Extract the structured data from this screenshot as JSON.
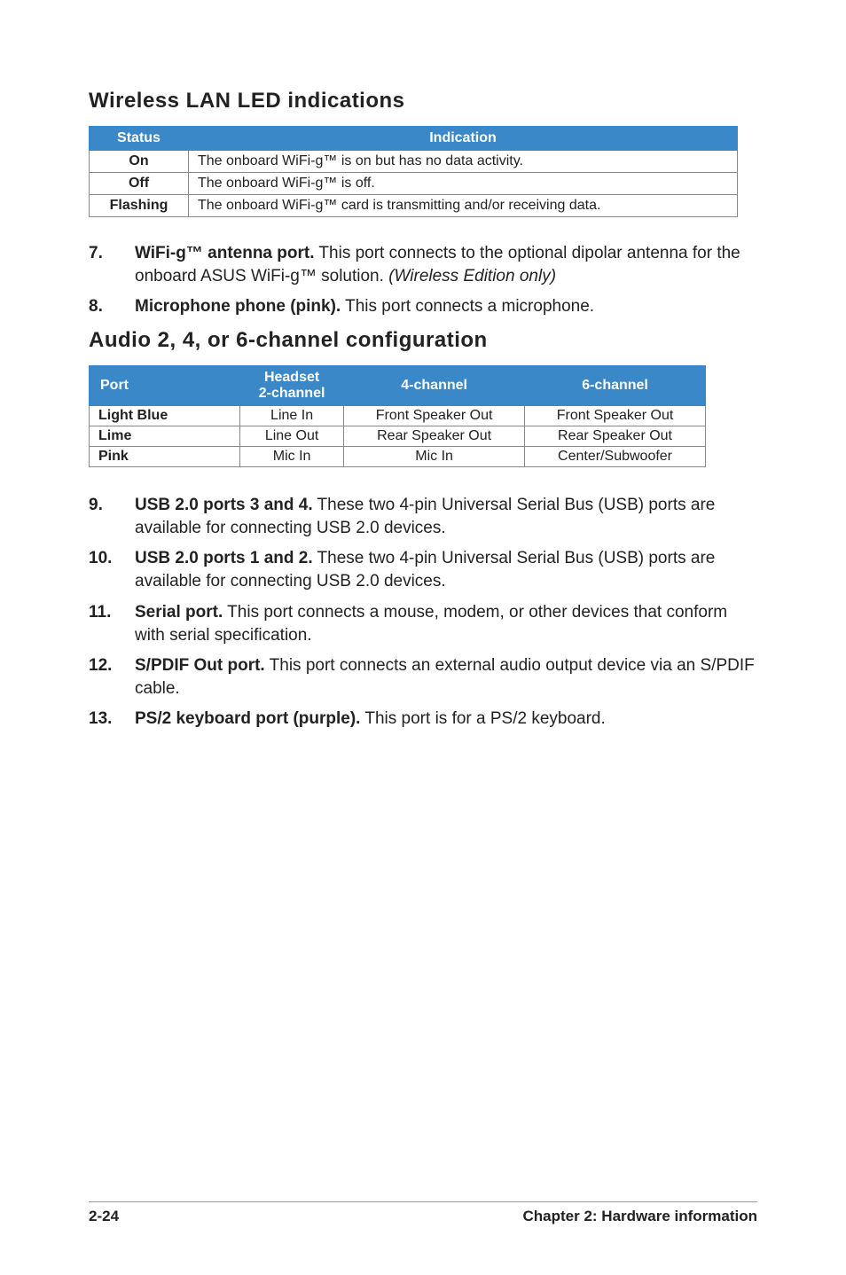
{
  "section1_title": "Wireless LAN LED indications",
  "t1": {
    "headers": {
      "status": "Status",
      "indication": "Indication"
    },
    "rows": [
      {
        "status": "On",
        "indication": "The onboard WiFi-g™ is on but has no data activity."
      },
      {
        "status": "Off",
        "indication": "The onboard WiFi-g™ is off."
      },
      {
        "status": "Flashing",
        "indication": "The onboard WiFi-g™ card is transmitting and/or receiving data."
      }
    ]
  },
  "item7": {
    "num": "7.",
    "bold": "WiFi-g™ antenna port.",
    "text": " This port connects to the optional dipolar antenna for the onboard ASUS WiFi-g™ solution. ",
    "ital": "(Wireless Edition only)"
  },
  "item8": {
    "num": "8.",
    "bold": "Microphone phone (pink).",
    "text": " This port connects a microphone."
  },
  "section2_title": "Audio 2, 4, or 6-channel configuration",
  "t2": {
    "headers": {
      "port": "Port",
      "headset": "Headset",
      "headset_sub": "2-channel",
      "ch4": "4-channel",
      "ch6": "6-channel"
    },
    "rows": [
      {
        "port": "Light Blue",
        "c1": "Line In",
        "c2": "Front Speaker Out",
        "c3": "Front Speaker Out"
      },
      {
        "port": "Lime",
        "c1": "Line Out",
        "c2": "Rear Speaker Out",
        "c3": "Rear Speaker Out"
      },
      {
        "port": "Pink",
        "c1": "Mic In",
        "c2": "Mic In",
        "c3": "Center/Subwoofer"
      }
    ]
  },
  "item9": {
    "num": "9.",
    "bold": "USB 2.0 ports 3 and 4.",
    "text": " These two 4-pin Universal Serial Bus (USB) ports are available for connecting USB 2.0 devices."
  },
  "item10": {
    "num": "10.",
    "bold": "USB 2.0 ports 1 and 2.",
    "text": " These two 4-pin Universal Serial Bus (USB) ports are available for connecting USB 2.0 devices."
  },
  "item11": {
    "num": "11.",
    "bold": "Serial port.",
    "text": " This port connects a mouse, modem, or other devices that conform with serial specification."
  },
  "item12": {
    "num": "12.",
    "bold": "S/PDIF Out port.",
    "text": " This port connects an external audio output device via an S/PDIF cable."
  },
  "item13": {
    "num": "13.",
    "bold": "PS/2 keyboard port (purple).",
    "text": " This port is for a PS/2 keyboard."
  },
  "footer": {
    "left": "2-24",
    "right": "Chapter 2: Hardware information"
  }
}
